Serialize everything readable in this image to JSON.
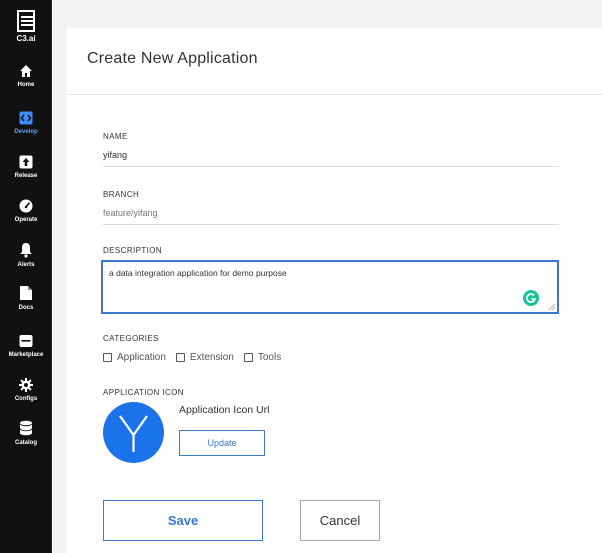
{
  "sidebar": {
    "logo_text": "C3.ai",
    "active_color": "#5aa0ff",
    "items": [
      {
        "label": "Home",
        "icon": "home-icon"
      },
      {
        "label": "Develop",
        "icon": "code-icon"
      },
      {
        "label": "Release",
        "icon": "upload-icon"
      },
      {
        "label": "Operate",
        "icon": "gauge-icon"
      },
      {
        "label": "Alerts",
        "icon": "bell-icon"
      },
      {
        "label": "Docs",
        "icon": "document-icon"
      },
      {
        "label": "Marketplace",
        "icon": "store-icon"
      },
      {
        "label": "Configs",
        "icon": "gear-icon"
      },
      {
        "label": "Catalog",
        "icon": "database-icon"
      }
    ]
  },
  "form": {
    "title": "Create New Application",
    "name": {
      "label": "NAME",
      "value": "yifang"
    },
    "branch": {
      "label": "BRANCH",
      "value": "feature/yifang"
    },
    "description": {
      "label": "DESCRIPTION",
      "value": "a data integration application for demo purpose"
    },
    "categories": {
      "label": "CATEGORIES",
      "options": [
        "Application",
        "Extension",
        "Tools"
      ]
    },
    "application_icon": {
      "label": "APPLICATION ICON",
      "avatar_letter": "Y",
      "url_label": "Application Icon Url",
      "update_label": "Update"
    },
    "save_label": "Save",
    "cancel_label": "Cancel"
  },
  "colors": {
    "accent": "#3a78c9",
    "sidebar_bg": "#111111",
    "avatar_bg": "#1a73e8",
    "grammarly": "#15c39a"
  }
}
